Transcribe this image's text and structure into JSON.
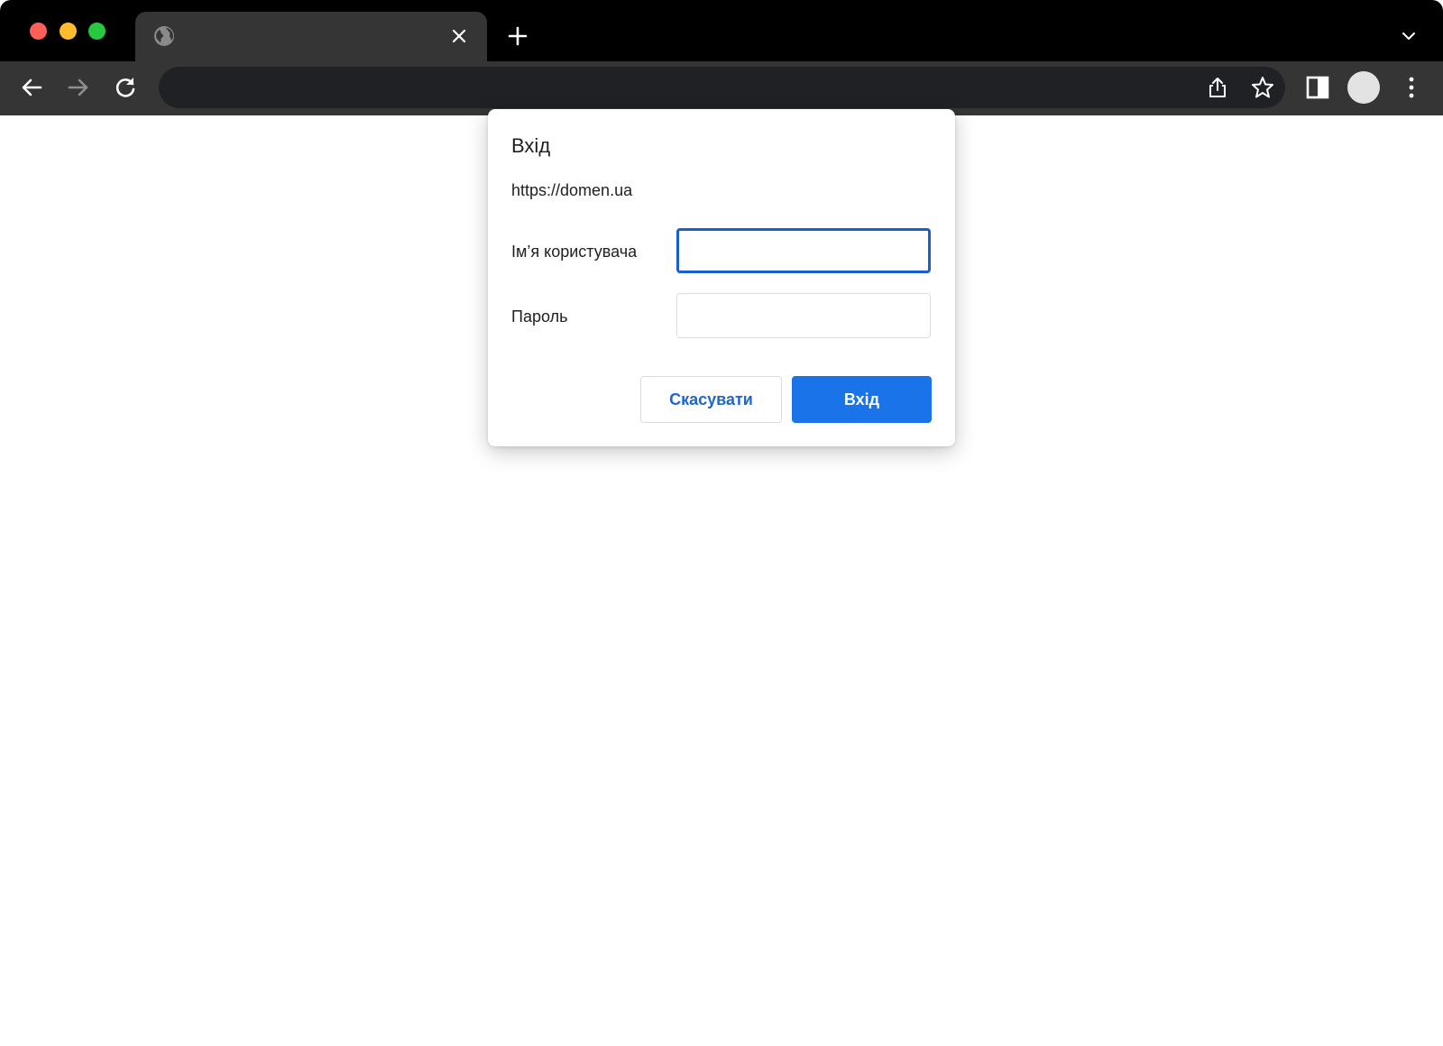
{
  "browser": {
    "tab": {
      "title": ""
    },
    "omnibox": {
      "value": "",
      "placeholder": ""
    }
  },
  "dialog": {
    "title": "Вхід",
    "origin": "https://domen.ua",
    "username": {
      "label": "Ім’я користувача",
      "value": ""
    },
    "password": {
      "label": "Пароль",
      "value": ""
    },
    "cancel_label": "Скасувати",
    "signin_label": "Вхід"
  },
  "colors": {
    "accent": "#1a73e8",
    "focus_ring": "#1a5fd0",
    "tabstrip": "#000000",
    "toolbar": "#353535",
    "omnibox": "#202124"
  }
}
